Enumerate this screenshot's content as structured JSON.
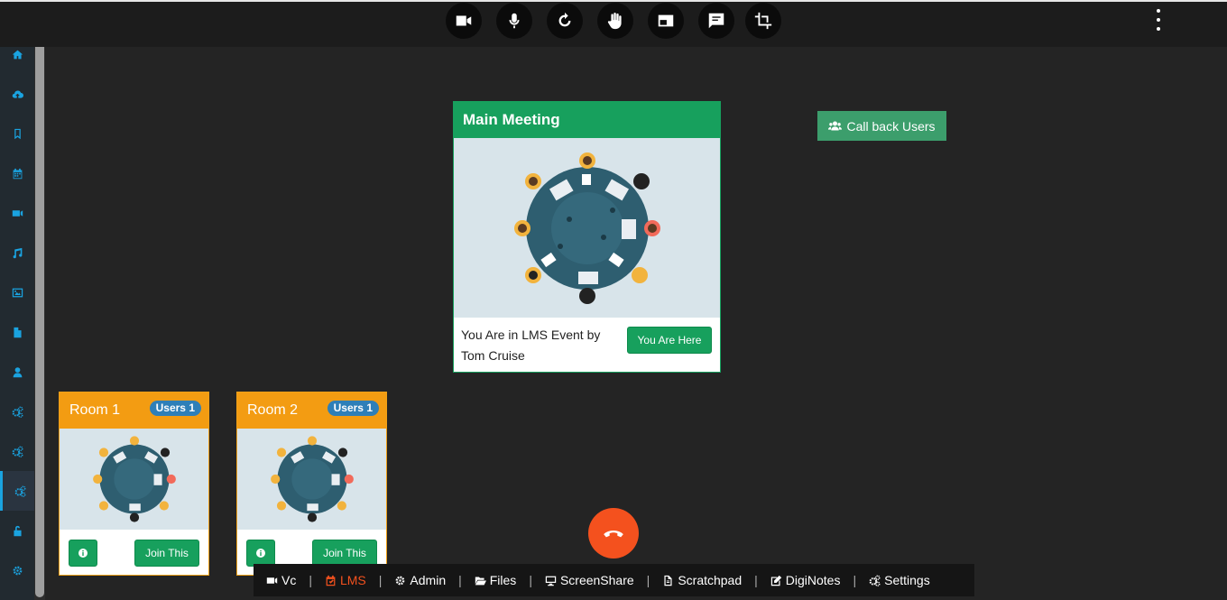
{
  "toolbar": {
    "icons": [
      "video-camera-icon",
      "microphone-icon",
      "refresh-icon",
      "raise-hand-icon",
      "screen-layout-icon",
      "chat-icon",
      "crop-icon"
    ],
    "more_icon": "kebab-menu-icon"
  },
  "sidebar": {
    "items": [
      {
        "icon": "home-icon"
      },
      {
        "icon": "cloud-upload-icon"
      },
      {
        "icon": "bookmark-icon"
      },
      {
        "icon": "calendar-icon"
      },
      {
        "icon": "video-icon"
      },
      {
        "icon": "music-icon"
      },
      {
        "icon": "image-icon"
      },
      {
        "icon": "file-icon"
      },
      {
        "icon": "user-icon"
      },
      {
        "icon": "cogs-icon"
      },
      {
        "icon": "cogs-icon"
      },
      {
        "icon": "cogs-icon",
        "active": true
      },
      {
        "icon": "unlock-icon"
      },
      {
        "icon": "gear-icon"
      }
    ],
    "accent": "#1aa3e0"
  },
  "main_meeting": {
    "title": "Main Meeting",
    "status_text": "You Are in LMS Event by Tom Cruise",
    "button_label": "You Are Here"
  },
  "callback": {
    "label": "Call back Users"
  },
  "rooms": [
    {
      "title": "Room 1",
      "badge": "Users 1",
      "join_label": "Join This"
    },
    {
      "title": "Room 2",
      "badge": "Users 1",
      "join_label": "Join This"
    }
  ],
  "bottom_nav": {
    "items": [
      {
        "label": "Vc",
        "icon": "video-camera-icon"
      },
      {
        "label": "LMS",
        "icon": "calendar-check-icon",
        "active": true
      },
      {
        "label": "Admin",
        "icon": "gear-icon"
      },
      {
        "label": "Files",
        "icon": "folder-open-icon"
      },
      {
        "label": "ScreenShare",
        "icon": "desktop-icon"
      },
      {
        "label": "Scratchpad",
        "icon": "document-icon"
      },
      {
        "label": "DigiNotes",
        "icon": "edit-icon"
      },
      {
        "label": "Settings",
        "icon": "cogs-icon"
      }
    ],
    "separator": "|"
  },
  "colors": {
    "green": "#17a05d",
    "orange": "#f39c12",
    "hangup": "#f4511e",
    "badge": "#2e7fb8"
  }
}
